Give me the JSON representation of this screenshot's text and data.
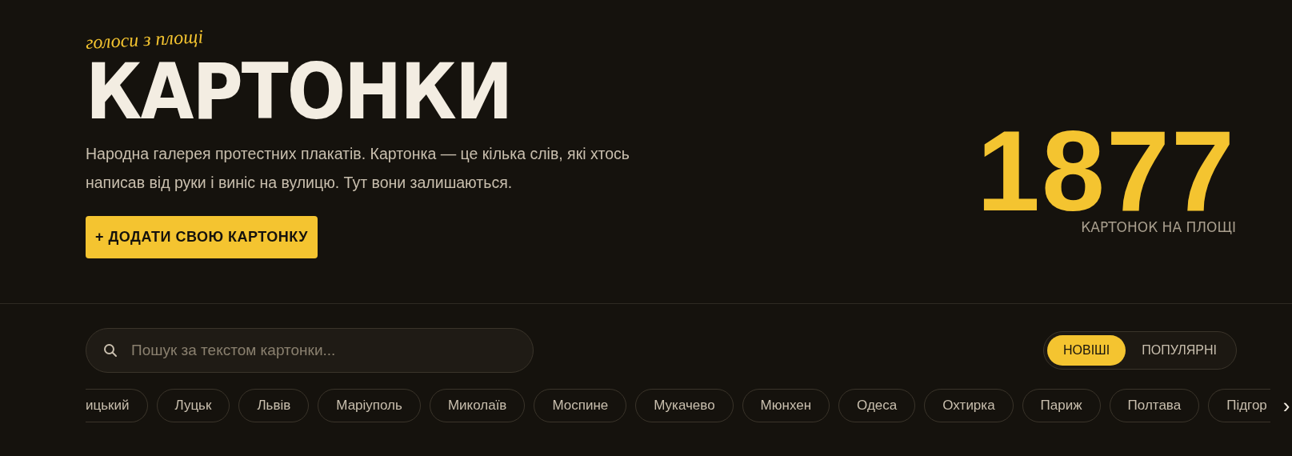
{
  "hero": {
    "tagline": "голоси з площі",
    "title": "КАРТОНКИ",
    "description": "Народна галерея протестних плакатів. Картонка — це кілька слів, які хтось написав від руки і виніс на вулицю. Тут вони залишаються.",
    "add_button": "+ ДОДАТИ СВОЮ КАРТОНКУ",
    "counter": {
      "value": "1877",
      "label": "КАРТОНОК НА ПЛОЩІ"
    }
  },
  "search": {
    "placeholder": "Пошук за текстом картонки..."
  },
  "sort_tabs": [
    {
      "label": "НОВІШІ",
      "selected": true
    },
    {
      "label": "ПОПУЛЯРНІ",
      "selected": false
    }
  ],
  "city_chips": [
    {
      "label": "ицький",
      "kind": "cut-start"
    },
    {
      "label": "Луцьк",
      "kind": "full"
    },
    {
      "label": "Львів",
      "kind": "full"
    },
    {
      "label": "Маріуполь",
      "kind": "full"
    },
    {
      "label": "Миколаїв",
      "kind": "full"
    },
    {
      "label": "Моспине",
      "kind": "full"
    },
    {
      "label": "Мукачево",
      "kind": "full"
    },
    {
      "label": "Мюнхен",
      "kind": "full"
    },
    {
      "label": "Одеса",
      "kind": "full"
    },
    {
      "label": "Охтирка",
      "kind": "full"
    },
    {
      "label": "Париж",
      "kind": "full"
    },
    {
      "label": "Полтава",
      "kind": "full"
    },
    {
      "label": "Підгор",
      "kind": "cut-end"
    }
  ],
  "chips_next": "›"
}
